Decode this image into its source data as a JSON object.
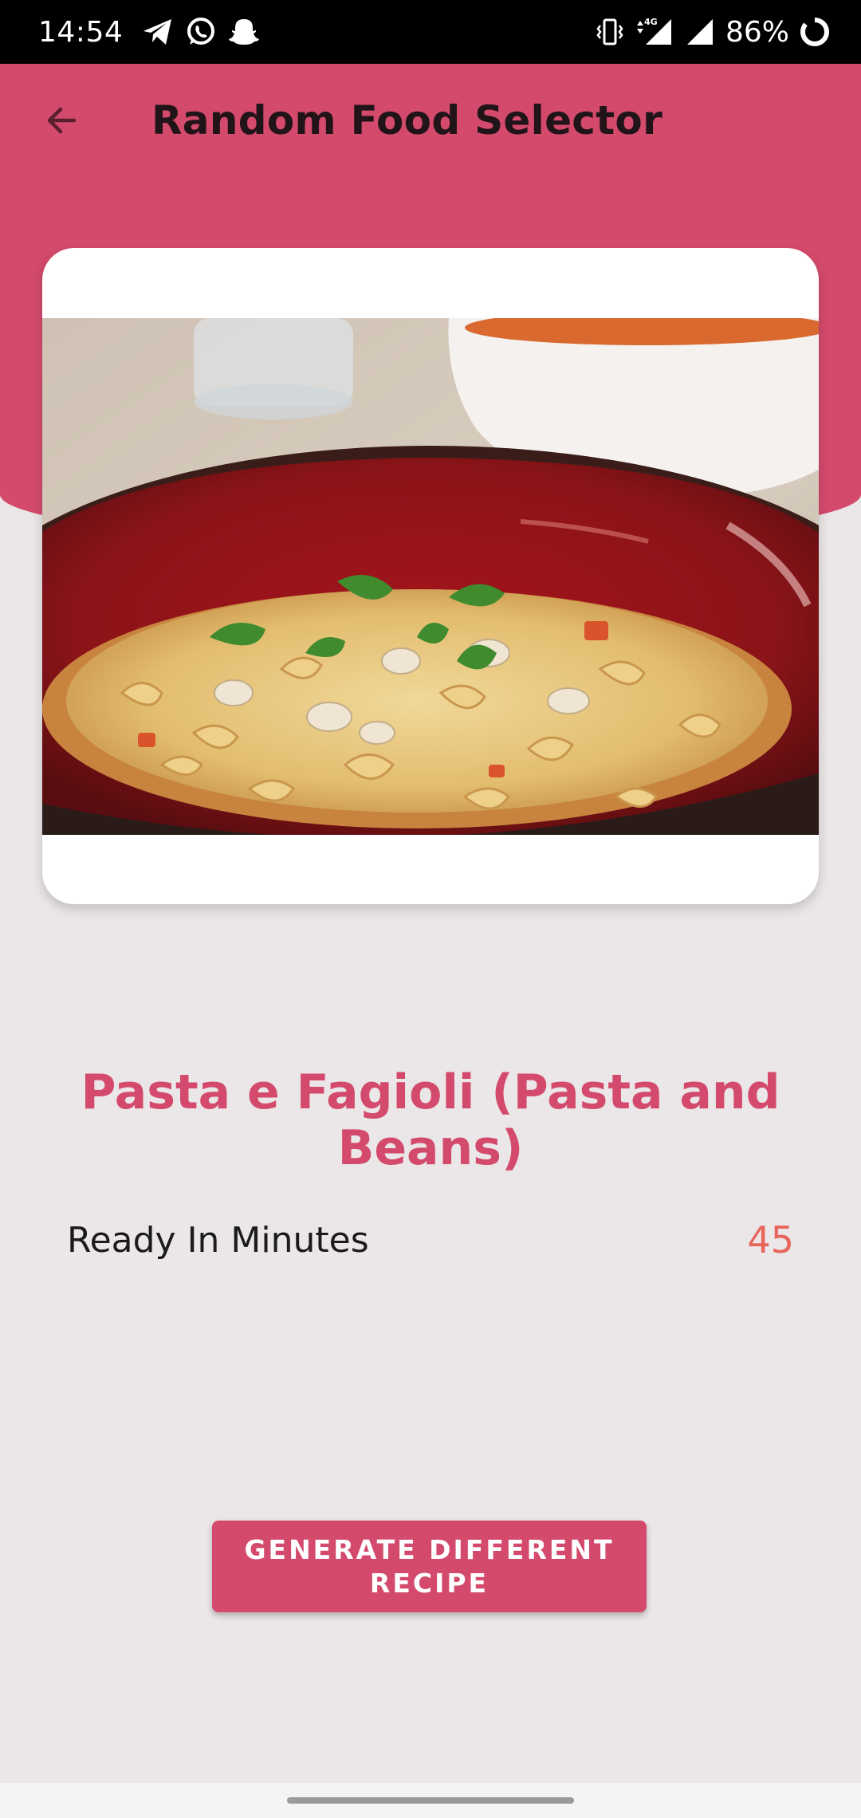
{
  "status_bar": {
    "time": "14:54",
    "notification_icons": [
      "telegram-icon",
      "whatsapp-icon",
      "snapchat-icon"
    ],
    "system_icons": [
      "vibrate-icon",
      "data-4g-icon",
      "signal-icon",
      "signal-icon"
    ],
    "battery_percent": "86%"
  },
  "app_bar": {
    "back_icon": "arrow-left-icon",
    "title": "Random Food Selector"
  },
  "recipe": {
    "image_description": "bowl of pasta e fagioli",
    "title": "Pasta e Fagioli (Pasta and Beans)",
    "ready_label": "Ready In Minutes",
    "ready_value": "45"
  },
  "actions": {
    "generate_label": "GENERATE DIFFERENT RECIPE"
  },
  "colors": {
    "accent": "#d34a6c",
    "value": "#e8655b",
    "background": "#ebe6e7"
  }
}
